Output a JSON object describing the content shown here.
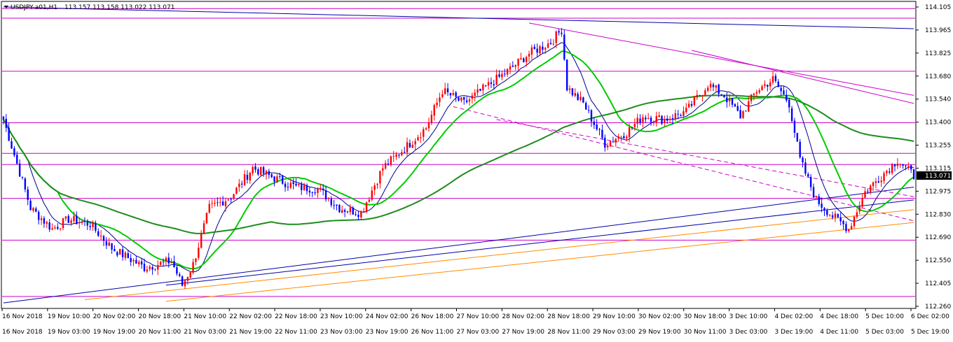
{
  "header": {
    "symbol": "USDJPY-a01,H1",
    "ohlc": "113.157 113.158 113.022 113.071"
  },
  "colors": {
    "background": "#ffffff",
    "grid_frame": "#000000",
    "bull": "#ff0000",
    "bear": "#0000ff",
    "ma_fast": "#00008b",
    "ma_mid": "#00cc00",
    "ma_slow": "#1e8c1e",
    "hlines": "#cc00cc",
    "trend_blue": "#0000aa",
    "trend_orange": "#ff8c00",
    "price_tag_bg": "#000000",
    "price_tag_fg": "#ffffff"
  },
  "chart_data": {
    "type": "candlestick",
    "y_ticks": [
      "114.105",
      "113.965",
      "113.825",
      "113.680",
      "113.540",
      "113.400",
      "113.255",
      "113.115",
      "112.975",
      "112.830",
      "112.690",
      "112.550",
      "112.405",
      "112.260"
    ],
    "current_price": "113.071",
    "ylim": [
      112.23,
      114.13
    ],
    "x_row1": [
      "16 Nov 2018",
      "20 Nov 02:00",
      "21 Nov 10:00",
      "22 Nov 18:00",
      "24 Nov 02:00",
      "27 Nov 03:00",
      "28 Nov 11:00",
      "29 Nov 19:00",
      "3 Dec 03:00",
      "4 Dec 11:00",
      "5 Dec 19:00"
    ],
    "x_row0": [
      "16 Nov 2018",
      "19 Nov 10:00",
      "20 Nov 18:00",
      "22 Nov 02:00",
      "23 Nov 10:00",
      "26 Nov 18:00",
      "28 Nov 02:00",
      "29 Nov 10:00",
      "30 Nov 18:00",
      "4 Dec 02:00",
      "5 Dec 10:00"
    ],
    "x_row2": [
      "16 Nov 2018",
      "19 Nov 03:00",
      "19 Nov 19:00",
      "20 Nov 11:00",
      "21 Nov 03:00",
      "21 Nov 19:00",
      "22 Nov 11:00",
      "23 Nov 03:00",
      "23 Nov 19:00",
      "26 Nov 11:00",
      "27 Nov 03:00",
      "27 Nov 19:00",
      "28 Nov 11:00",
      "29 Nov 03:00",
      "29 Nov 19:00",
      "30 Nov 11:00",
      "3 Dec 03:00",
      "3 Dec 19:00",
      "4 Dec 11:00",
      "5 Dec 03:00",
      "5 Dec 19:00"
    ],
    "x_row_top": [
      "16 Nov 2018",
      "19 Nov 10:00",
      "20 Nov 02:00",
      "20 Nov 18:00",
      "21 Nov 10:00",
      "22 Nov 02:00",
      "22 Nov 18:00",
      "23 Nov 10:00",
      "24 Nov 02:00",
      "26 Nov 18:00",
      "27 Nov 10:00",
      "28 Nov 02:00",
      "28 Nov 18:00",
      "29 Nov 10:00",
      "30 Nov 02:00",
      "30 Nov 18:00",
      "3 Dec 10:00",
      "4 Dec 02:00",
      "4 Dec 18:00",
      "5 Dec 10:00",
      "6 Dec 02:00"
    ],
    "horizontal_levels": [
      114.09,
      114.03,
      113.7,
      113.38,
      113.19,
      113.12,
      112.91,
      112.65,
      112.3
    ],
    "waypoints": [
      [
        0,
        113.4
      ],
      [
        4,
        113.18
      ],
      [
        10,
        112.85
      ],
      [
        18,
        112.72
      ],
      [
        24,
        112.78
      ],
      [
        32,
        112.75
      ],
      [
        40,
        112.6
      ],
      [
        52,
        112.48
      ],
      [
        62,
        112.52
      ],
      [
        66,
        112.37
      ],
      [
        70,
        112.5
      ],
      [
        76,
        112.85
      ],
      [
        84,
        112.92
      ],
      [
        92,
        113.1
      ],
      [
        98,
        113.05
      ],
      [
        108,
        112.98
      ],
      [
        116,
        112.97
      ],
      [
        124,
        112.85
      ],
      [
        132,
        112.82
      ],
      [
        140,
        113.1
      ],
      [
        148,
        113.22
      ],
      [
        156,
        113.35
      ],
      [
        162,
        113.58
      ],
      [
        170,
        113.5
      ],
      [
        178,
        113.6
      ],
      [
        186,
        113.7
      ],
      [
        194,
        113.81
      ],
      [
        202,
        113.88
      ],
      [
        206,
        113.96
      ],
      [
        208,
        113.6
      ],
      [
        214,
        113.5
      ],
      [
        222,
        113.25
      ],
      [
        230,
        113.32
      ],
      [
        236,
        113.42
      ],
      [
        244,
        113.4
      ],
      [
        252,
        113.45
      ],
      [
        260,
        113.62
      ],
      [
        266,
        113.55
      ],
      [
        272,
        113.42
      ],
      [
        278,
        113.58
      ],
      [
        284,
        113.65
      ],
      [
        290,
        113.5
      ],
      [
        294,
        113.15
      ],
      [
        300,
        112.9
      ],
      [
        306,
        112.8
      ],
      [
        312,
        112.72
      ],
      [
        318,
        112.95
      ],
      [
        324,
        113.05
      ],
      [
        330,
        113.15
      ],
      [
        336,
        113.05
      ]
    ],
    "ma_periods": [
      10,
      21,
      100
    ]
  }
}
